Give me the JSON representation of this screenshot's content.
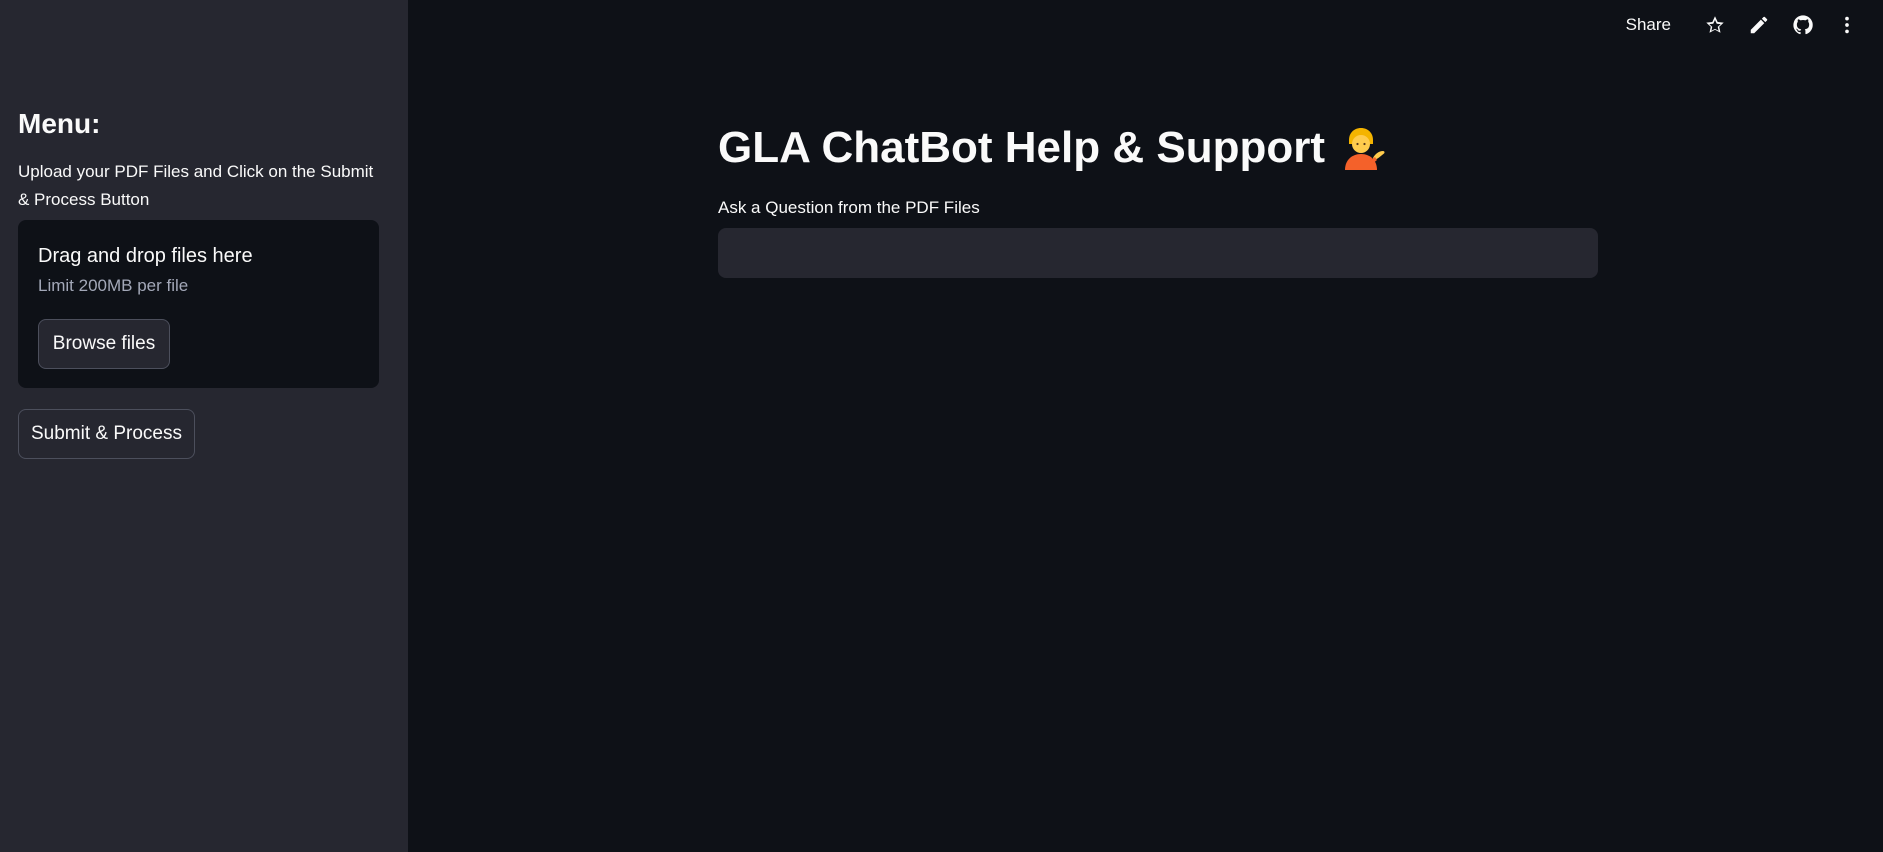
{
  "header": {
    "share_label": "Share",
    "icons": [
      "star-icon",
      "pencil-icon",
      "github-icon",
      "more-vertical-icon"
    ]
  },
  "sidebar": {
    "heading": "Menu:",
    "instructions": "Upload your PDF Files and Click on the Submit & Process Button",
    "uploader": {
      "title": "Drag and drop files here",
      "limit": "Limit 200MB per file",
      "browse_label": "Browse files"
    },
    "submit_label": "Submit & Process"
  },
  "main": {
    "title": "GLA ChatBot Help & Support",
    "title_emoji": "person-tipping-hand-icon",
    "question_label": "Ask a Question from the PDF Files",
    "question_value": ""
  },
  "colors": {
    "background": "#0e1117",
    "sidebar": "#262730",
    "input": "#262730",
    "text": "#fafafa",
    "muted_text": "#a3a8b8"
  }
}
